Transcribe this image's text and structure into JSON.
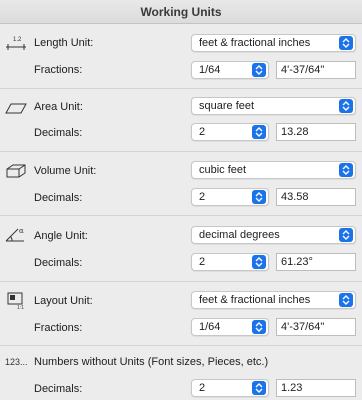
{
  "window": {
    "title": "Working Units"
  },
  "sections": {
    "length": {
      "label": "Length Unit:",
      "unit": "feet & fractional inches",
      "sub_label": "Fractions:",
      "sub_value": "1/64",
      "preview": "4'-37/64\""
    },
    "area": {
      "label": "Area Unit:",
      "unit": "square feet",
      "sub_label": "Decimals:",
      "sub_value": "2",
      "preview": "13.28"
    },
    "volume": {
      "label": "Volume Unit:",
      "unit": "cubic feet",
      "sub_label": "Decimals:",
      "sub_value": "2",
      "preview": "43.58"
    },
    "angle": {
      "label": "Angle Unit:",
      "unit": "decimal degrees",
      "sub_label": "Decimals:",
      "sub_value": "2",
      "preview": "61.23°"
    },
    "layout": {
      "label": "Layout Unit:",
      "unit": "feet & fractional inches",
      "sub_label": "Fractions:",
      "sub_value": "1/64",
      "preview": "4'-37/64\""
    },
    "numbers": {
      "icon_text": "123...",
      "label": "Numbers without Units (Font sizes, Pieces, etc.)",
      "sub_label": "Decimals:",
      "sub_value": "2",
      "preview": "1.23"
    }
  },
  "icons": {
    "length": "ruler-length-icon",
    "area": "parallelogram-area-icon",
    "volume": "box-volume-icon",
    "angle": "angle-icon",
    "layout": "layout-sheet-icon"
  },
  "colors": {
    "accent": "#1a73e8"
  }
}
